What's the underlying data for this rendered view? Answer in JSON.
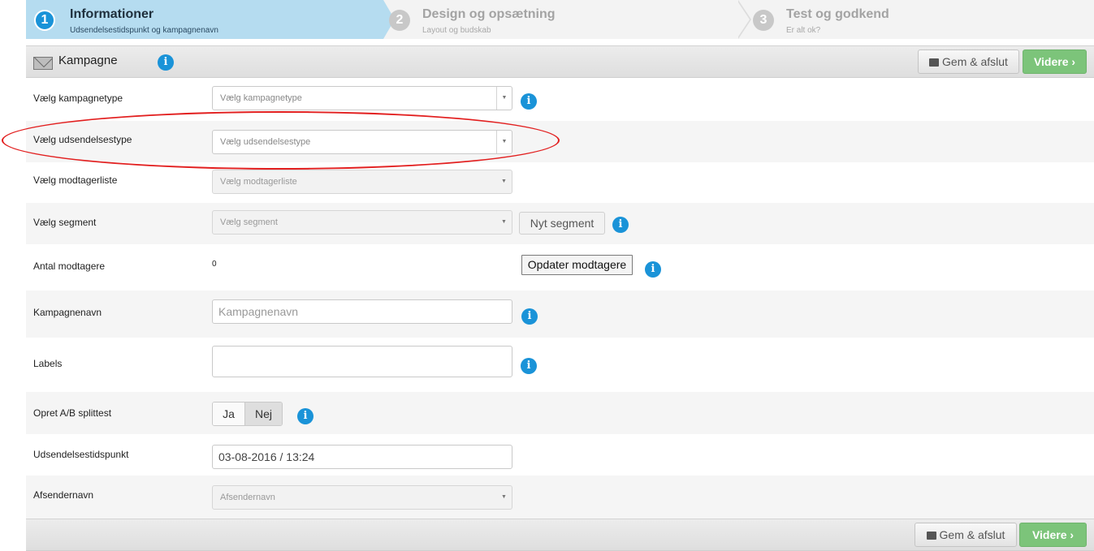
{
  "steps": [
    {
      "num": "1",
      "title": "Informationer",
      "subtitle": "Udsendelsestidspunkt og kampagnenavn"
    },
    {
      "num": "2",
      "title": "Design og opsætning",
      "subtitle": "Layout og budskab"
    },
    {
      "num": "3",
      "title": "Test og godkend",
      "subtitle": "Er alt ok?"
    }
  ],
  "header": {
    "title": "Kampagne",
    "info": "i"
  },
  "actions": {
    "save": "Gem & afslut",
    "next": "Videre ›"
  },
  "form": {
    "campaign_type": {
      "label": "Vælg kampagnetype",
      "placeholder": "Vælg kampagnetype"
    },
    "send_type": {
      "label": "Vælg udsendelsestype",
      "placeholder": "Vælg udsendelsestype"
    },
    "recipient_list": {
      "label": "Vælg modtagerliste",
      "placeholder": "Vælg modtagerliste"
    },
    "segment": {
      "label": "Vælg segment",
      "placeholder": "Vælg segment",
      "button": "Nyt segment"
    },
    "recipients": {
      "label": "Antal modtagere",
      "value": "0",
      "button": "Opdater modtagere"
    },
    "campaign_name": {
      "label": "Kampagnenavn",
      "placeholder": "Kampagnenavn"
    },
    "labels": {
      "label": "Labels",
      "value": ""
    },
    "ab_test": {
      "label": "Opret A/B splittest",
      "yes": "Ja",
      "no": "Nej",
      "selected": "Nej"
    },
    "send_time": {
      "label": "Udsendelsestidspunkt",
      "value": "03-08-2016 / 13:24"
    },
    "sender": {
      "label": "Afsendernavn",
      "placeholder": "Afsendernavn"
    }
  },
  "colors": {
    "accent": "#1a93d8",
    "next": "#7cc47a",
    "highlight": "#e21f1f",
    "active_step": "#b5dcf0"
  }
}
